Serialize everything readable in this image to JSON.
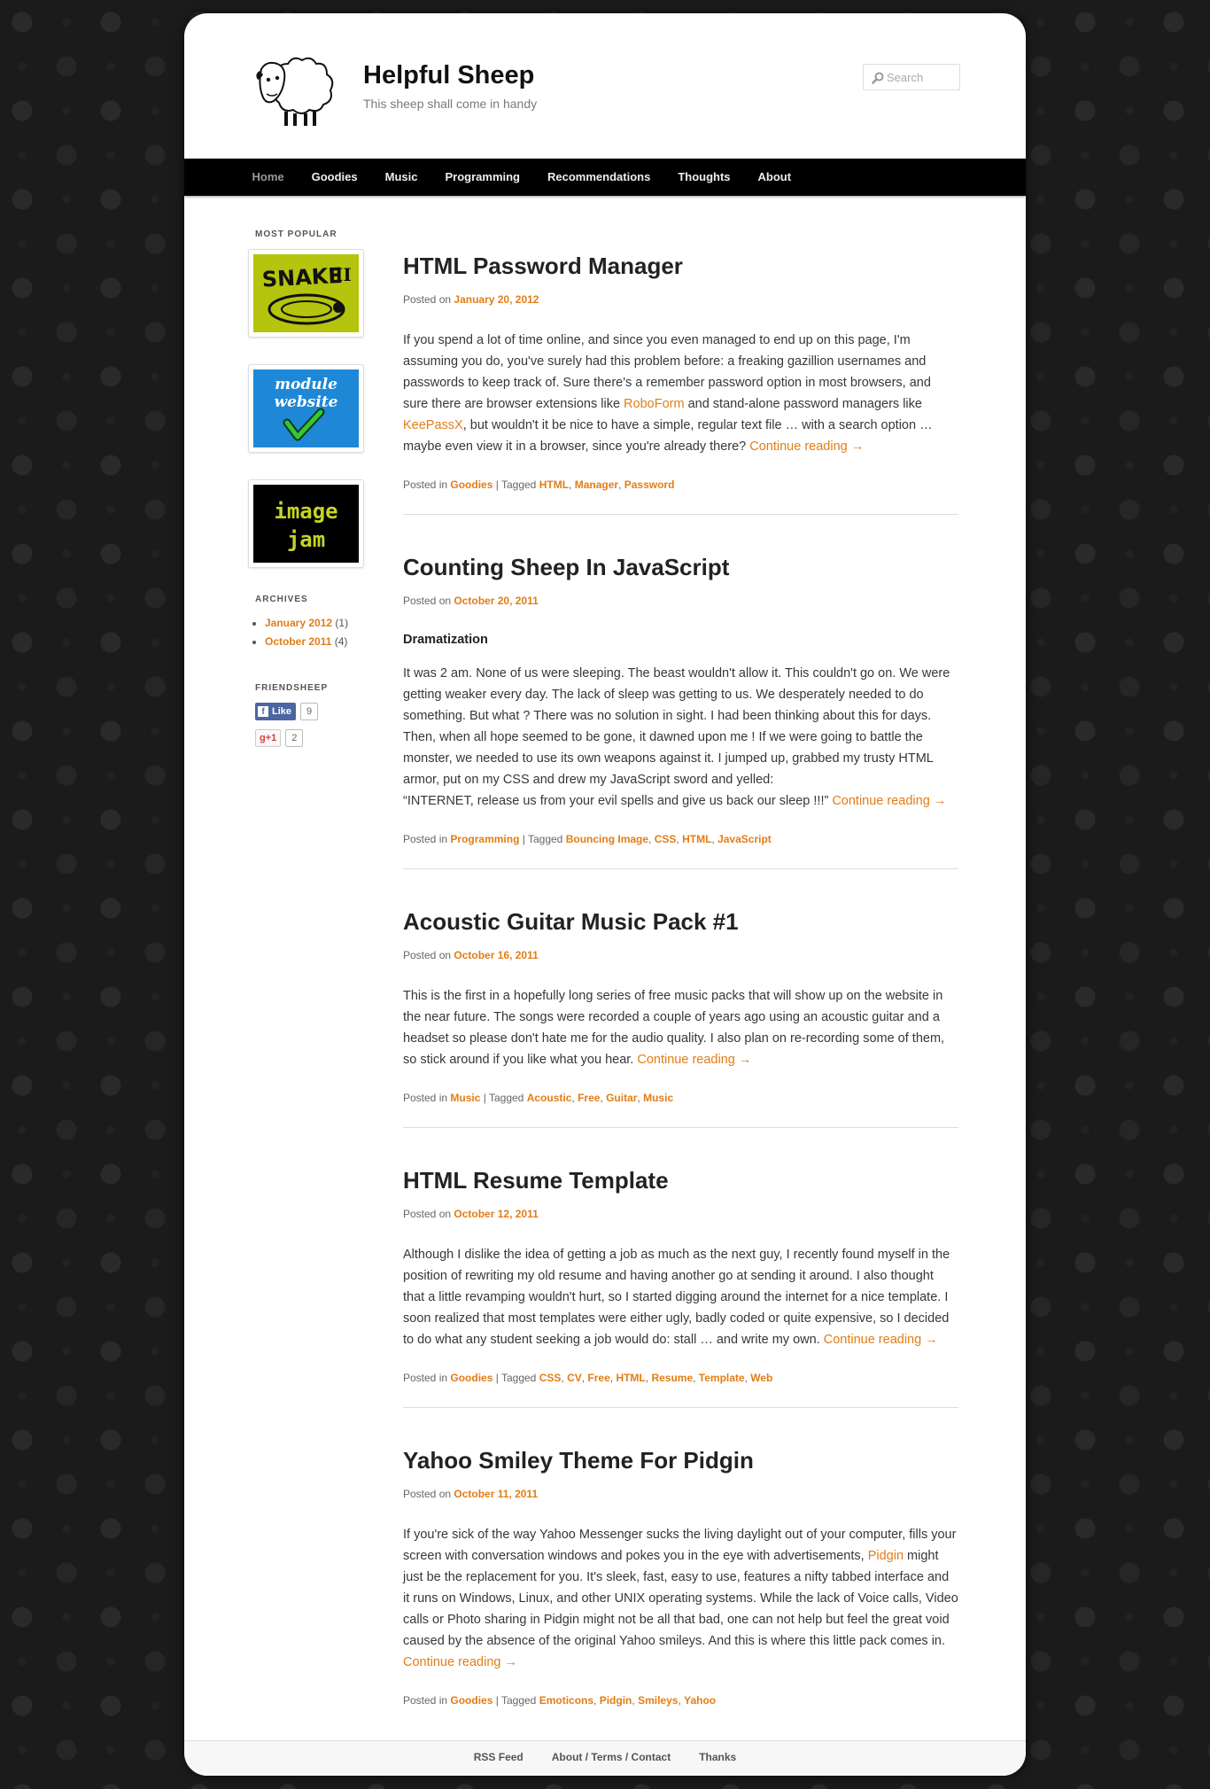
{
  "site": {
    "title": "Helpful Sheep",
    "description": "This sheep shall come in handy"
  },
  "search": {
    "placeholder": "Search"
  },
  "nav": {
    "items": [
      "Home",
      "Goodies",
      "Music",
      "Programming",
      "Recommendations",
      "Thoughts",
      "About"
    ]
  },
  "sidebar": {
    "popular_title": "MOST POPULAR",
    "popular_images": [
      {
        "line1": "SNAKE",
        "line2": "II"
      },
      {
        "line1": "module",
        "line2": "website"
      },
      {
        "line1": "image",
        "line2": "jam"
      }
    ],
    "archives_title": "ARCHIVES",
    "archives": [
      {
        "label": "January 2012",
        "count": "(1)"
      },
      {
        "label": "October 2011",
        "count": "(4)"
      }
    ],
    "friends_title": "FRIENDSHEEP",
    "fb_like_label": "Like",
    "fb_like_count": "9",
    "gplus_label": "+1",
    "gplus_count": "2"
  },
  "posts": [
    {
      "title": "HTML Password Manager",
      "posted_on": "Posted on",
      "date": "January 20, 2012",
      "p1": "If you spend a lot of time online, and since you even managed to end up on this page, I'm assuming you do, you've surely had this problem before: a freaking gazillion usernames and passwords to keep track of. Sure there's a remember password option in most browsers, and sure there are browser extensions like ",
      "link1": "RoboForm",
      "p2": " and stand-alone password managers like ",
      "link2": "KeePassX",
      "p3": ", but wouldn't it be nice to have a simple, regular text file … with a search option … maybe even view it in a browser, since you're already there? ",
      "continue": "Continue reading →",
      "posted_in": "Posted in",
      "category": "Goodies",
      "tagged": "| Tagged",
      "tags": [
        "HTML",
        "Manager",
        "Password"
      ]
    },
    {
      "title": "Counting Sheep In JavaScript",
      "posted_on": "Posted on",
      "date": "October 20, 2011",
      "heading": "Dramatization",
      "p1": "It was 2 am. None of us were sleeping. The beast wouldn't allow it. This couldn't go on. We were getting weaker every day. The lack of sleep was getting to us. We desperately needed to do something. But what ? There was no solution in sight. I had been thinking about this for days. Then, when all hope seemed to be gone, it dawned upon me ! If we were going to battle the monster, we needed to use its own weapons against it. I jumped up, grabbed my trusty HTML armor, put on my CSS and drew my JavaScript sword and yelled:",
      "p2": "“INTERNET, release us from your evil spells and give us back our sleep !!!” ",
      "continue": "Continue reading →",
      "posted_in": "Posted in",
      "category": "Programming",
      "tagged": "| Tagged",
      "tags": [
        "Bouncing Image",
        "CSS",
        "HTML",
        "JavaScript"
      ]
    },
    {
      "title": "Acoustic Guitar Music Pack #1",
      "posted_on": "Posted on",
      "date": "October 16, 2011",
      "p1": "This is the first in a hopefully long series of free music packs that will show up on the website in the near future. The songs were recorded a couple of years ago using an acoustic guitar and a headset so please don't hate me for the audio quality. I also plan on re-recording some of them, so stick around if you like what you hear. ",
      "continue": "Continue reading →",
      "posted_in": "Posted in",
      "category": "Music",
      "tagged": "| Tagged",
      "tags": [
        "Acoustic",
        "Free",
        "Guitar",
        "Music"
      ]
    },
    {
      "title": "HTML Resume Template",
      "posted_on": "Posted on",
      "date": "October 12, 2011",
      "p1": "Although I dislike the idea of getting a job as much as the next guy, I recently found myself in the position of rewriting my old resume and having another go at sending it around. I also thought that a little revamping wouldn't hurt, so I started digging around the internet for a nice template. I soon realized that most templates were either ugly, badly coded or quite expensive, so I decided to do what any student seeking a job would do: stall … and write my own. ",
      "continue": "Continue reading →",
      "posted_in": "Posted in",
      "category": "Goodies",
      "tagged": "| Tagged",
      "tags": [
        "CSS",
        "CV",
        "Free",
        "HTML",
        "Resume",
        "Template",
        "Web"
      ]
    },
    {
      "title": "Yahoo Smiley Theme For Pidgin",
      "posted_on": "Posted on",
      "date": "October 11, 2011",
      "p1": "If you're sick of the way Yahoo Messenger sucks the living daylight out of your computer, fills your screen with conversation windows and pokes you in the eye with advertisements, ",
      "link1": "Pidgin",
      "p2": " might just be the replacement for you. It's sleek, fast, easy to use, features a nifty tabbed interface and it runs on Windows, Linux, and other UNIX operating systems. While the lack of Voice calls, Video calls or Photo sharing in Pidgin might not be all that bad, one can not help but feel the great void caused by the absence of the original Yahoo smileys. And this is where this little pack comes in. ",
      "continue": "Continue reading →",
      "posted_in": "Posted in",
      "category": "Goodies",
      "tagged": "| Tagged",
      "tags": [
        "Emoticons",
        "Pidgin",
        "Smileys",
        "Yahoo"
      ]
    }
  ],
  "footer": {
    "links": [
      "RSS Feed",
      "About / Terms / Contact",
      "Thanks"
    ]
  },
  "colors": {
    "accent": "#e37d15",
    "nav_bg": "#000000",
    "snake_bg": "#b5c40c",
    "module_bg": "#1e88d6",
    "jam_bg": "#000000",
    "jam_text": "#c5d423"
  }
}
